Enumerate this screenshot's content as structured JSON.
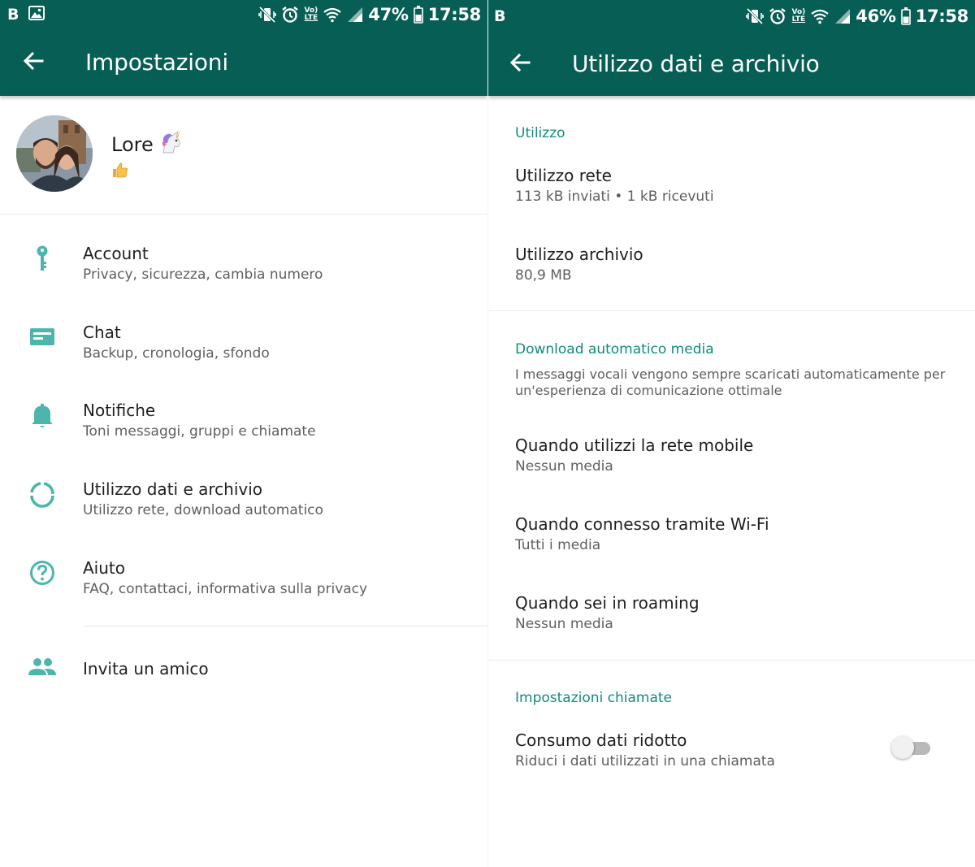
{
  "colors": {
    "primary_dark": "#075e54",
    "accent": "#128c7e",
    "icon_teal": "#4db6ac",
    "text_primary": "#1f1f1f",
    "text_secondary": "#5f5f5f"
  },
  "left_screen": {
    "status_bar": {
      "carrier_letter": "B",
      "icons": [
        "gallery-icon",
        "vibrate-mute-icon",
        "alarm-icon",
        "volte-icon",
        "wifi-icon",
        "signal-icon",
        "battery-icon"
      ],
      "volte_top": "Vo)",
      "volte_bottom": "LTE",
      "battery": "47%",
      "time": "17:58"
    },
    "app_bar": {
      "back_icon": "arrow-back-icon",
      "title": "Impostazioni"
    },
    "profile": {
      "name": "Lore",
      "name_emoji_icon": "unicorn-icon",
      "status_emoji_icon": "thumbs-up-icon"
    },
    "menu": [
      {
        "icon": "key-icon",
        "title": "Account",
        "subtitle": "Privacy, sicurezza, cambia numero"
      },
      {
        "icon": "chat-icon",
        "title": "Chat",
        "subtitle": "Backup, cronologia, sfondo"
      },
      {
        "icon": "bell-icon",
        "title": "Notifiche",
        "subtitle": "Toni messaggi, gruppi e chiamate"
      },
      {
        "icon": "data-usage-icon",
        "title": "Utilizzo dati e archivio",
        "subtitle": "Utilizzo rete, download automatico"
      },
      {
        "icon": "help-icon",
        "title": "Aiuto",
        "subtitle": "FAQ, contattaci, informativa sulla privacy"
      },
      {
        "icon": "people-icon",
        "title": "Invita un amico",
        "subtitle": ""
      }
    ]
  },
  "right_screen": {
    "status_bar": {
      "carrier_letter": "B",
      "icons": [
        "vibrate-mute-icon",
        "alarm-icon",
        "volte-icon",
        "wifi-icon",
        "signal-icon",
        "battery-icon"
      ],
      "volte_top": "Vo)",
      "volte_bottom": "LTE",
      "battery": "46%",
      "time": "17:58"
    },
    "app_bar": {
      "back_icon": "arrow-back-icon",
      "title": "Utilizzo dati e archivio"
    },
    "sections": {
      "usage": {
        "header": "Utilizzo",
        "network": {
          "title": "Utilizzo rete",
          "subtitle": "113 kB inviati • 1 kB ricevuti"
        },
        "storage": {
          "title": "Utilizzo archivio",
          "subtitle": "80,9 MB"
        }
      },
      "auto_download": {
        "header": "Download automatico media",
        "hint": "I messaggi vocali vengono sempre scaricati automaticamente per un'esperienza di comunicazione ottimale",
        "mobile": {
          "title": "Quando utilizzi la rete mobile",
          "subtitle": "Nessun media"
        },
        "wifi": {
          "title": "Quando connesso tramite Wi-Fi",
          "subtitle": "Tutti i media"
        },
        "roaming": {
          "title": "Quando sei in roaming",
          "subtitle": "Nessun media"
        }
      },
      "calls": {
        "header": "Impostazioni chiamate",
        "low_data": {
          "title": "Consumo dati ridotto",
          "subtitle": "Riduci i dati utilizzati in una chiamata",
          "enabled": false
        }
      }
    }
  }
}
